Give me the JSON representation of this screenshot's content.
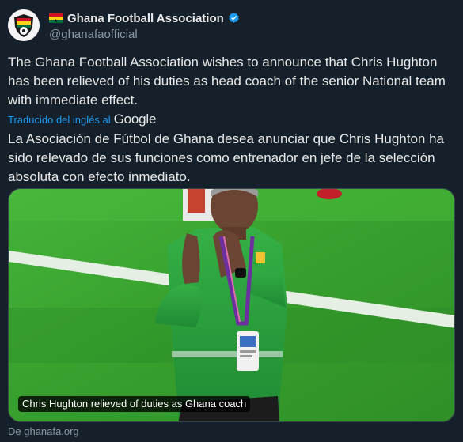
{
  "account": {
    "display_name": "Ghana Football Association",
    "handle": "@ghanafaofficial"
  },
  "icons": {
    "avatar": "gfa-crest-logo",
    "flag": "ghana-flag-emoji",
    "verified": "verified-badge-icon"
  },
  "tweet": {
    "text_original": "The Ghana Football Association wishes to announce that Chris Hughton has been relieved of his duties as head coach of the senior National team with immediate effect.",
    "translated_from_label": "Traducido del inglés al",
    "translator_name": "Google",
    "text_translated": "La Asociación de Fútbol de Ghana desea anunciar que Chris Hughton ha sido relevado de sus funciones como entrenador en jefe de la selección absoluta con efecto inmediato."
  },
  "card": {
    "caption": "Chris Hughton relieved of duties as Ghana coach",
    "source": "De ghanafa.org"
  },
  "colors": {
    "background": "#15202b",
    "link": "#1d9bf0",
    "muted": "#8b98a5",
    "pitch": "#3aa02e",
    "shirt": "#2e9e3c"
  }
}
